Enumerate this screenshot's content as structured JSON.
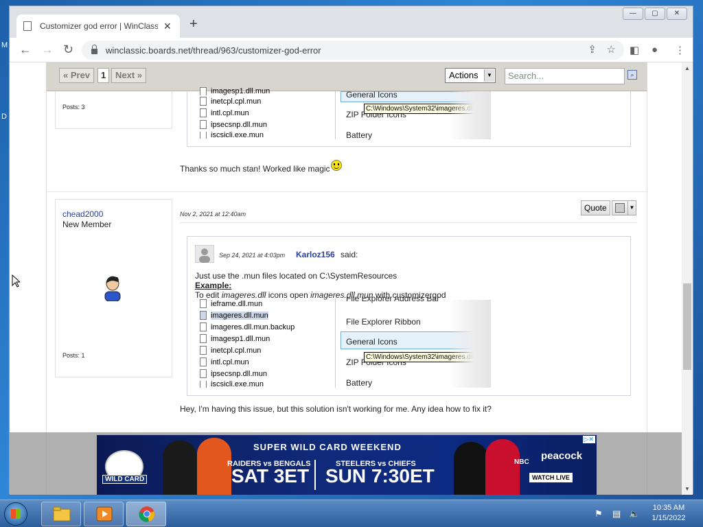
{
  "desktop": {
    "edge_glyph_1": "M",
    "edge_glyph_2": "D"
  },
  "browser": {
    "tab_title": "Customizer god error | WinClassic",
    "tab_close": "✕",
    "new_tab": "+",
    "window_controls": [
      "—",
      "▢",
      "✕"
    ],
    "url": "winclassic.boards.net/thread/963/customizer-god-error"
  },
  "forum": {
    "pagination": {
      "prev": "« Prev",
      "current": "1",
      "next": "Next »"
    },
    "actions_label": "Actions",
    "search_placeholder": "Search...",
    "post1": {
      "posts_count": "Posts: 3",
      "files": [
        "inetcpl.cpl.mun",
        "intl.cpl.mun",
        "ipsecsnp.dll.mun",
        "iscsicli.exe.mun"
      ],
      "options": [
        "General Icons",
        "ZIP Folder Icons",
        "Battery"
      ],
      "tooltip": "C:\\Windows\\System32\\imageres.dll",
      "message": "Thanks so much stan! Worked like magic"
    },
    "post2": {
      "username": "chead2000",
      "user_title": "New Member",
      "posts_count": "Posts: 1",
      "date": "Nov 2, 2021 at 12:40am",
      "quote_button": "Quote",
      "quote": {
        "date": "Sep 24, 2021 at 4:03pm",
        "author": "Karloz156",
        "said": "said:",
        "line1": "Just use the .mun files located on C:\\SystemResources",
        "example_label": "Example:",
        "line2_prefix": "To edit ",
        "line2_file1": "imageres.dll",
        "line2_mid": " icons open ",
        "line2_file2": "imageres.dll.mun",
        "line2_suffix": " with customizergod",
        "files": [
          "iefra​me.dll.mun",
          "imageres.dll.mun",
          "imageres.dll.mun.backup",
          "imagesp1.dll.mun",
          "inetcpl.cpl.mun",
          "intl.cpl.mun",
          "ipsecsnp.dll.mun",
          "iscsicli.exe.mun"
        ],
        "options": [
          "File Explorer Address Bar",
          "File Explorer Ribbon",
          "General Icons",
          "ZIP Folder Icons",
          "Battery"
        ],
        "tooltip": "C:\\Windows\\System32\\imageres.dll"
      },
      "message": "Hey, I'm having this issue, but this solution isn't working for me. Any idea how to fix it?"
    }
  },
  "ad": {
    "headline": "SUPER WILD CARD WEEKEND",
    "game1_teams": "RAIDERS vs BENGALS",
    "game1_time": "SAT 3ET",
    "game2_teams": "STEELERS vs CHIEFS",
    "game2_time": "SUN 7:30ET",
    "wild_card": "WILD CARD",
    "network": "NBC",
    "streaming": "peacock",
    "cta": "WATCH LIVE",
    "choices_badge": "▷✕"
  },
  "taskbar": {
    "time": "10:35 AM",
    "date": "1/15/2022"
  }
}
